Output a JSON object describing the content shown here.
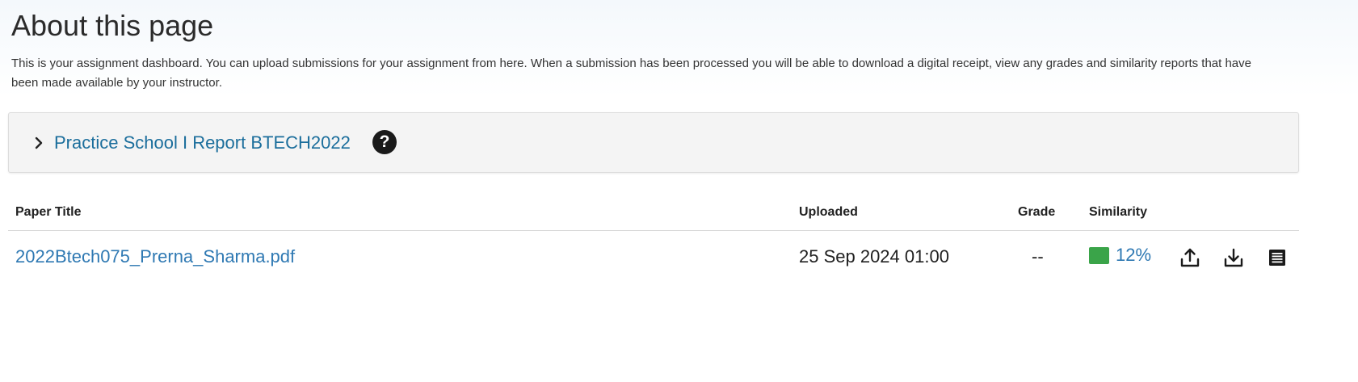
{
  "page": {
    "title": "About this page",
    "intro": "This is your assignment dashboard. You can upload submissions for your assignment from here. When a submission has been processed you will be able to download a digital receipt, view any grades and similarity reports that have been made available by your instructor."
  },
  "assignment": {
    "title": "Practice School I Report BTECH2022",
    "toggle_icon": "chevron-right-icon",
    "help_icon": "question-circle-icon",
    "help_glyph": "?"
  },
  "table": {
    "headers": {
      "paper_title": "Paper Title",
      "uploaded": "Uploaded",
      "grade": "Grade",
      "similarity": "Similarity"
    },
    "rows": [
      {
        "paper_title": "2022Btech075_Prerna_Sharma.pdf",
        "uploaded": "25 Sep 2024 01:00",
        "grade": "--",
        "similarity": "12%",
        "similarity_color": "#3aa449",
        "actions": [
          "upload-icon",
          "download-icon",
          "receipt-icon"
        ]
      }
    ]
  },
  "colors": {
    "link": "#2f79b3",
    "assignment_link": "#1b6e9c",
    "panel_background": "#f4f4f4",
    "similarity_green": "#3aa449"
  }
}
